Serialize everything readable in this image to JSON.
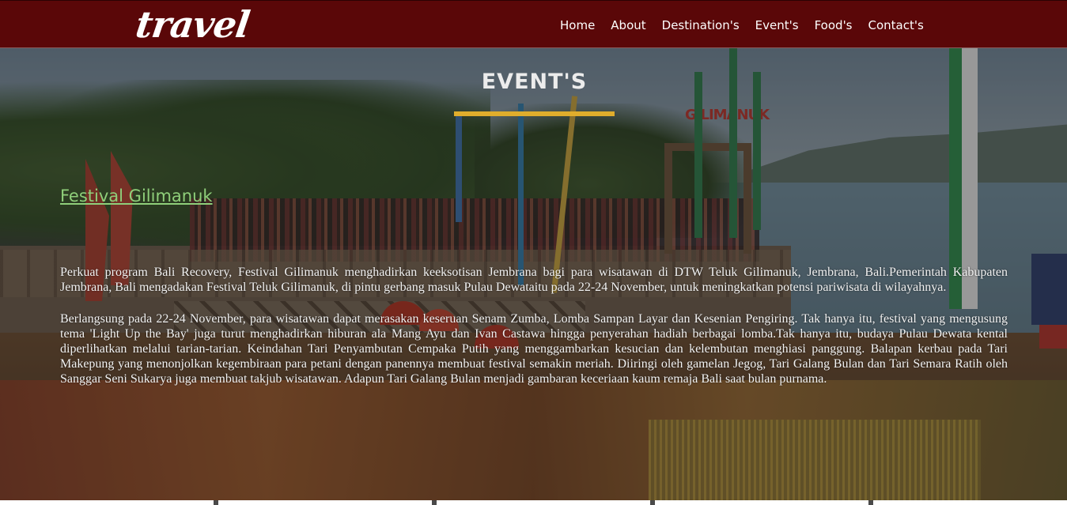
{
  "navbar": {
    "logo": "travel",
    "links": [
      "Home",
      "About",
      "Destination's",
      "Event's",
      "Food's",
      "Contact's"
    ]
  },
  "background": {
    "sign_text": "GILIMANUK"
  },
  "section": {
    "title": "EVENT'S"
  },
  "article": {
    "title": "Festival Gilimanuk",
    "paragraphs": [
      "Perkuat program Bali Recovery, Festival Gilimanuk menghadirkan keeksotisan Jembrana bagi para wisatawan di DTW Teluk Gilimanuk, Jembrana, Bali.Pemerintah Kabupaten Jembrana, Bali mengadakan Festival Teluk Gilimanuk, di pintu gerbang masuk Pulau Dewataitu pada 22-24 November, untuk meningkatkan potensi pariwisata di wilayahnya.",
      "Berlangsung pada 22-24 November, para wisatawan dapat merasakan keseruan Senam Zumba, Lomba Sampan Layar dan Kesenian Pengiring. Tak hanya itu, festival yang mengusung tema 'Light Up the Bay' juga turut menghadirkan hiburan ala Mang Ayu dan Ivan Castawa hingga penyerahan hadiah berbagai lomba.Tak hanya itu, budaya Pulau Dewata kental diperlihatkan melalui tarian-tarian. Keindahan Tari Penyambutan Cempaka Putih yang menggambarkan kesucian dan kelembutan menghiasi panggung. Balapan kerbau pada Tari Makepung yang menonjolkan kegembiraan para petani dengan panennya membuat festival semakin meriah. Diiringi oleh gamelan Jegog, Tari Galang Bulan dan Tari Semara Ratih oleh Sanggar Seni Sukarya juga membuat takjub wisatawan. Adapun Tari Galang Bulan menjadi gambaran keceriaan kaum remaja Bali saat bulan purnama."
    ]
  },
  "colors": {
    "navbar_bg": "#5a0708",
    "accent_underline": "#e0ad2c",
    "article_title": "#8fcf7a",
    "text": "#f2f2f2"
  }
}
